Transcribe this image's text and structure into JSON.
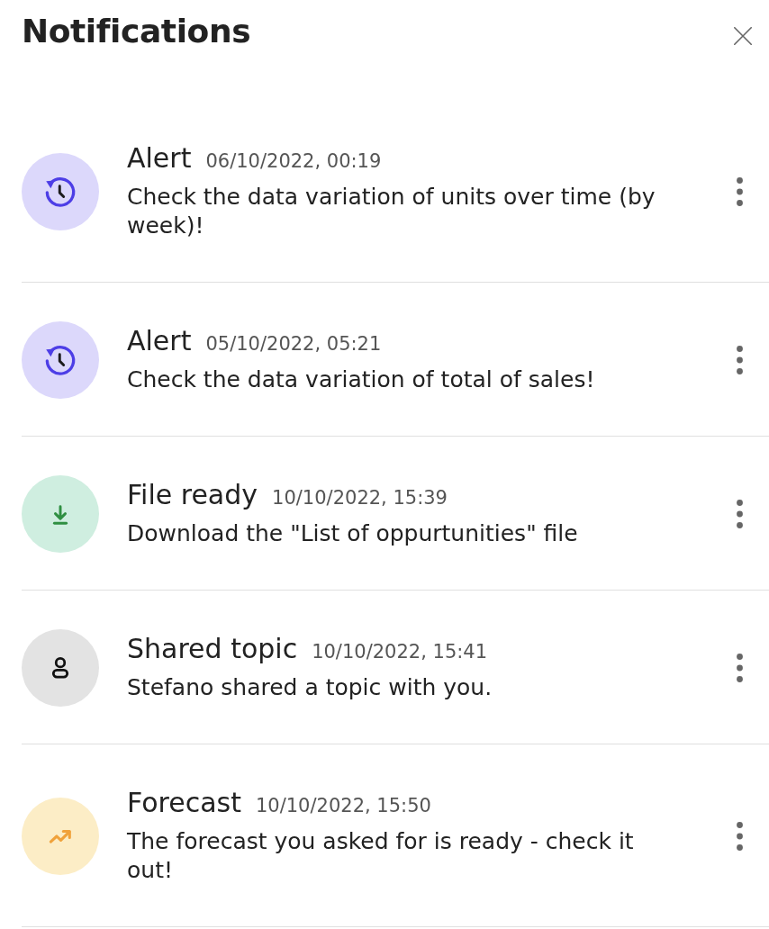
{
  "header": {
    "title": "Notifications"
  },
  "notifications": [
    {
      "kind": "alert",
      "title": "Alert",
      "time": "06/10/2022, 00:19",
      "message": "Check the data variation of units over time (by week)!"
    },
    {
      "kind": "alert",
      "title": "Alert",
      "time": "05/10/2022, 05:21",
      "message": "Check the data variation of total of sales!"
    },
    {
      "kind": "file",
      "title": "File ready",
      "time": "10/10/2022, 15:39",
      "message": "Download the \"List of oppurtunities\" file"
    },
    {
      "kind": "share",
      "title": "Shared topic",
      "time": "10/10/2022, 15:41",
      "message": "Stefano shared a topic with you."
    },
    {
      "kind": "forecast",
      "title": "Forecast",
      "time": "10/10/2022, 15:50",
      "message": "The forecast you asked for is ready - check it out!"
    }
  ]
}
